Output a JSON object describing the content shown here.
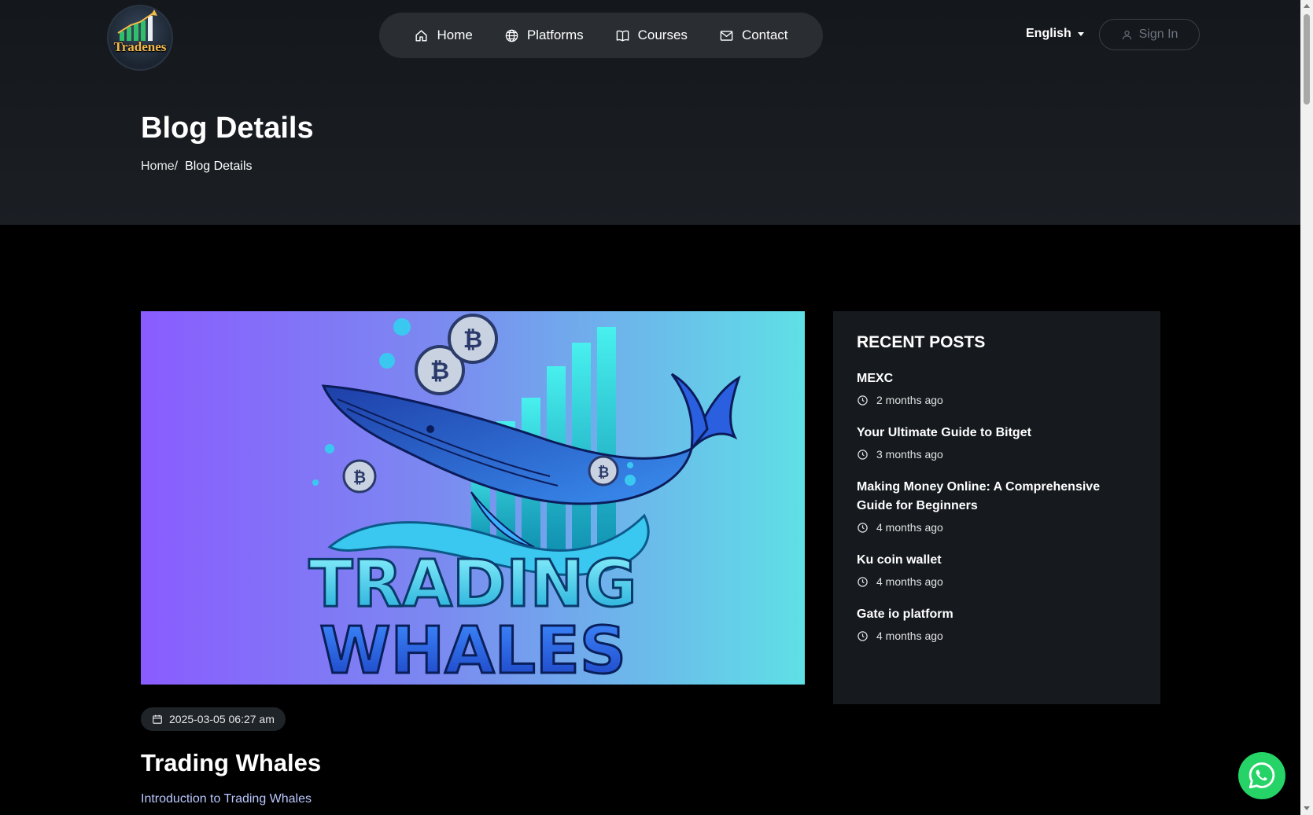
{
  "brand": {
    "logo_text": "Tradenes"
  },
  "nav": {
    "items": [
      {
        "label": "Home",
        "icon": "home-icon"
      },
      {
        "label": "Platforms",
        "icon": "globe-icon"
      },
      {
        "label": "Courses",
        "icon": "book-icon"
      },
      {
        "label": "Contact",
        "icon": "mail-icon"
      }
    ]
  },
  "header": {
    "language": "English",
    "sign_in": "Sign In"
  },
  "page": {
    "title": "Blog Details",
    "breadcrumb": {
      "home": "Home/",
      "current": "Blog Details"
    }
  },
  "featured_image": {
    "line1": "TRADING",
    "line2": "WHALES"
  },
  "sidebar": {
    "heading": "RECENT POSTS",
    "posts": [
      {
        "title": "MEXC",
        "time": "2 months ago"
      },
      {
        "title": "Your Ultimate Guide to Bitget",
        "time": "3 months ago"
      },
      {
        "title": "Making Money Online: A Comprehensive Guide for Beginners",
        "time": "4 months ago"
      },
      {
        "title": "Ku coin wallet",
        "time": "4 months ago"
      },
      {
        "title": "Gate io platform",
        "time": "4 months ago"
      }
    ]
  },
  "article": {
    "date": "2025-03-05 06:27 am",
    "title": "Trading Whales",
    "intro": "Introduction to Trading Whales"
  },
  "colors": {
    "accent_gradient_start": "#8a5cff",
    "accent_gradient_end": "#5fe0e6",
    "whatsapp": "#25d366",
    "panel": "#161a1f"
  }
}
